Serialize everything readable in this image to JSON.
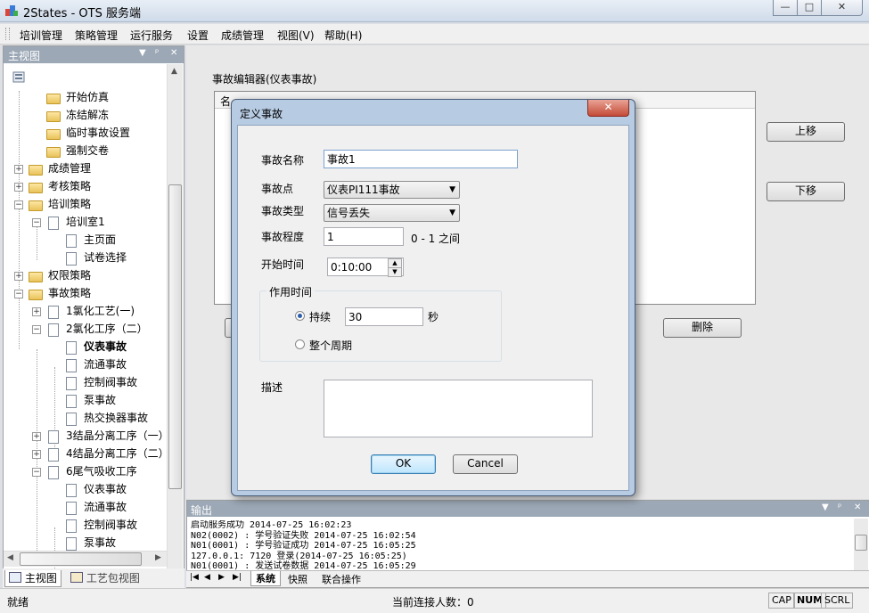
{
  "window": {
    "title": "2States - OTS 服务端",
    "controls": {
      "minimize": "—",
      "maximize": "□",
      "close": "✕"
    }
  },
  "menu": [
    "培训管理",
    "策略管理",
    "运行服务",
    "设置",
    "成绩管理",
    "视图(V)",
    "帮助(H)"
  ],
  "left_pane": {
    "title": "主视图",
    "header_buttons": {
      "dropdown": "▼",
      "pin": "ᵖ",
      "close": "✕"
    },
    "tree": [
      "开始仿真",
      "冻结解冻",
      "临时事故设置",
      "强制交卷",
      "成绩管理",
      "考核策略",
      "培训策略",
      "培训室1",
      "主页面",
      "试卷选择",
      "权限策略",
      "事故策略",
      "1氯化工艺(一)",
      "2氯化工序（二）",
      "仪表事故",
      "流通事故",
      "控制阀事故",
      "泵事故",
      "热交换器事故",
      "3结晶分离工序（一）",
      "4结晶分离工序（二）",
      "6尾气吸收工序",
      "仪表事故",
      "流通事故",
      "控制阀事故",
      "泵事故"
    ],
    "tabs": [
      "主视图",
      "工艺包视图"
    ]
  },
  "editor": {
    "label": "事故编辑器(仪表事故)",
    "col_header_partial": "名",
    "buttons": {
      "up": "上移",
      "down": "下移",
      "delete": "删除"
    }
  },
  "dialog": {
    "title": "定义事故",
    "close": "✕",
    "fields": {
      "name_label": "事故名称",
      "name_value": "事故1",
      "point_label": "事故点",
      "point_value": "仪表PI111事故",
      "type_label": "事故类型",
      "type_value": "信号丢失",
      "degree_label": "事故程度",
      "degree_value": "1",
      "degree_hint": "0 - 1 之间",
      "start_label": "开始时间",
      "start_value": "0:10:00",
      "group_label": "作用时间",
      "duration_label": "持续",
      "duration_value": "30",
      "duration_unit": "秒",
      "whole_cycle_label": "整个周期",
      "desc_label": "描述",
      "desc_value": ""
    },
    "ok": "OK",
    "cancel": "Cancel"
  },
  "output": {
    "title": "输出",
    "lines": [
      "启动服务成功 2014-07-25 16:02:23",
      "N02(0002) : 学号验证失败 2014-07-25 16:02:54",
      "N01(0001) : 学号验证成功 2014-07-25 16:05:25",
      "127.0.0.1: 7120 登录(2014-07-25 16:05:25)",
      "N01(0001) : 发送试卷数据 2014-07-25 16:05:29"
    ],
    "tabs": [
      "系统",
      "快照",
      "联合操作"
    ],
    "nav": [
      "|◀",
      "◀",
      "▶",
      "▶|"
    ]
  },
  "status": {
    "left": "就绪",
    "center": "当前连接人数：0",
    "indicators": [
      "CAP",
      "NUM",
      "SCRL"
    ]
  }
}
